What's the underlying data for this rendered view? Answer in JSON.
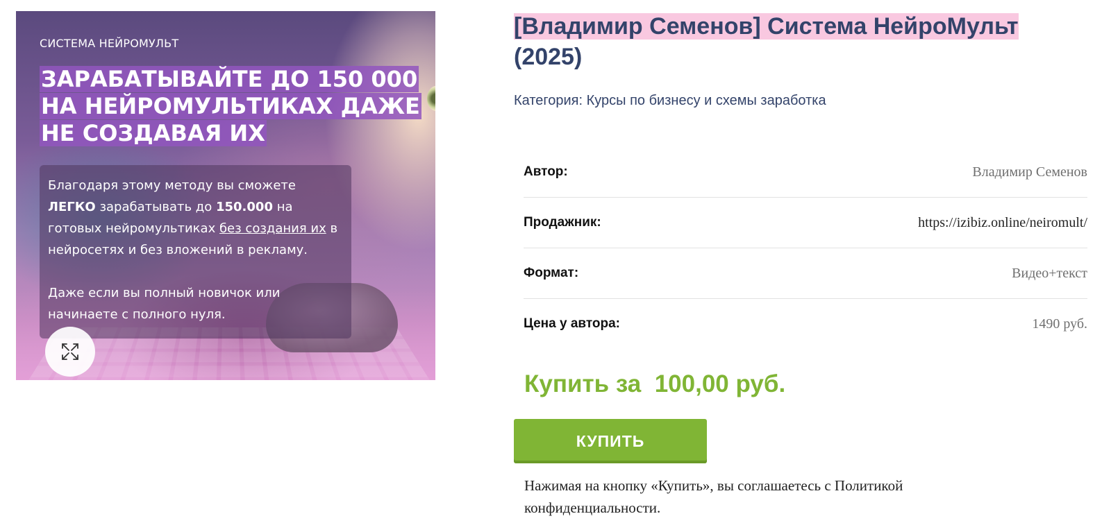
{
  "image": {
    "brand": "СИСТЕМА НЕЙРОМУЛЬТ",
    "headline": "ЗАРАБАТЫВАЙТЕ ДО 150 000 НА НЕЙРОМУЛЬТИКАХ ДАЖЕ НЕ СОЗДАВАЯ ИХ",
    "desc_1a": "Благодаря этому методу вы сможете ",
    "desc_1b": "ЛЕГКО",
    "desc_1c": " зарабатывать до ",
    "desc_1d": "150.000",
    "desc_1e": " на готовых нейромультиках ",
    "desc_1f": "без создания их",
    "desc_1g": " в нейросетях и без вложений в рекламу.",
    "desc_2": "Даже если вы полный новичок или начинаете с полного нуля.",
    "zoom_icon": "expand-icon"
  },
  "product": {
    "title": "[Владимир Семенов] Система НейроМульт",
    "title_suffix": "(2025)",
    "category_label": "Категория: ",
    "category_link": "Курсы по бизнесу и схемы заработка"
  },
  "attributes": [
    {
      "label": "Автор:",
      "value": "Владимир Семенов"
    },
    {
      "label": "Продажник:",
      "value": "https://izibiz.online/neiromult/"
    },
    {
      "label": "Формат:",
      "value": "Видео+текст"
    },
    {
      "label": "Цена у автора:",
      "value": "1490 руб."
    }
  ],
  "purchase": {
    "price_text": "Купить за  100,00 руб.",
    "buy_label": "КУПИТЬ",
    "consent": "Нажимая на кнопку «Купить», вы соглашаетесь с Политикой конфиденциальности."
  },
  "colors": {
    "accent_green": "#80b535",
    "title_navy": "#33436a",
    "title_highlight": "#f9c8e0"
  }
}
